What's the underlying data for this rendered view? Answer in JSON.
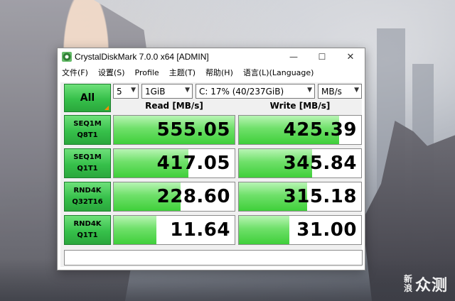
{
  "window": {
    "title": "CrystalDiskMark 7.0.0 x64 [ADMIN]",
    "controls": {
      "minimize": "—",
      "maximize": "☐",
      "close": "✕"
    }
  },
  "menu": [
    "文件(F)",
    "设置(S)",
    "Profile",
    "主题(T)",
    "帮助(H)",
    "语言(L)(Language)"
  ],
  "toolbar": {
    "all_label": "All",
    "count": "5",
    "size": "1GiB",
    "drive": "C: 17% (40/237GiB)",
    "unit": "MB/s"
  },
  "headers": {
    "read": "Read [MB/s]",
    "write": "Write [MB/s]"
  },
  "rows": [
    {
      "line1": "SEQ1M",
      "line2": "Q8T1",
      "read": "555.05",
      "write": "425.39",
      "read_fill": 1.0,
      "write_fill": 0.82
    },
    {
      "line1": "SEQ1M",
      "line2": "Q1T1",
      "read": "417.05",
      "write": "345.84",
      "read_fill": 0.62,
      "write_fill": 0.6
    },
    {
      "line1": "RND4K",
      "line2": "Q32T16",
      "read": "228.60",
      "write": "315.18",
      "read_fill": 0.55,
      "write_fill": 0.56
    },
    {
      "line1": "RND4K",
      "line2": "Q1T1",
      "read": "11.64",
      "write": "31.00",
      "read_fill": 0.35,
      "write_fill": 0.41
    }
  ],
  "comment": "",
  "watermark": {
    "small1": "新",
    "small2": "浪",
    "big": "众测"
  }
}
